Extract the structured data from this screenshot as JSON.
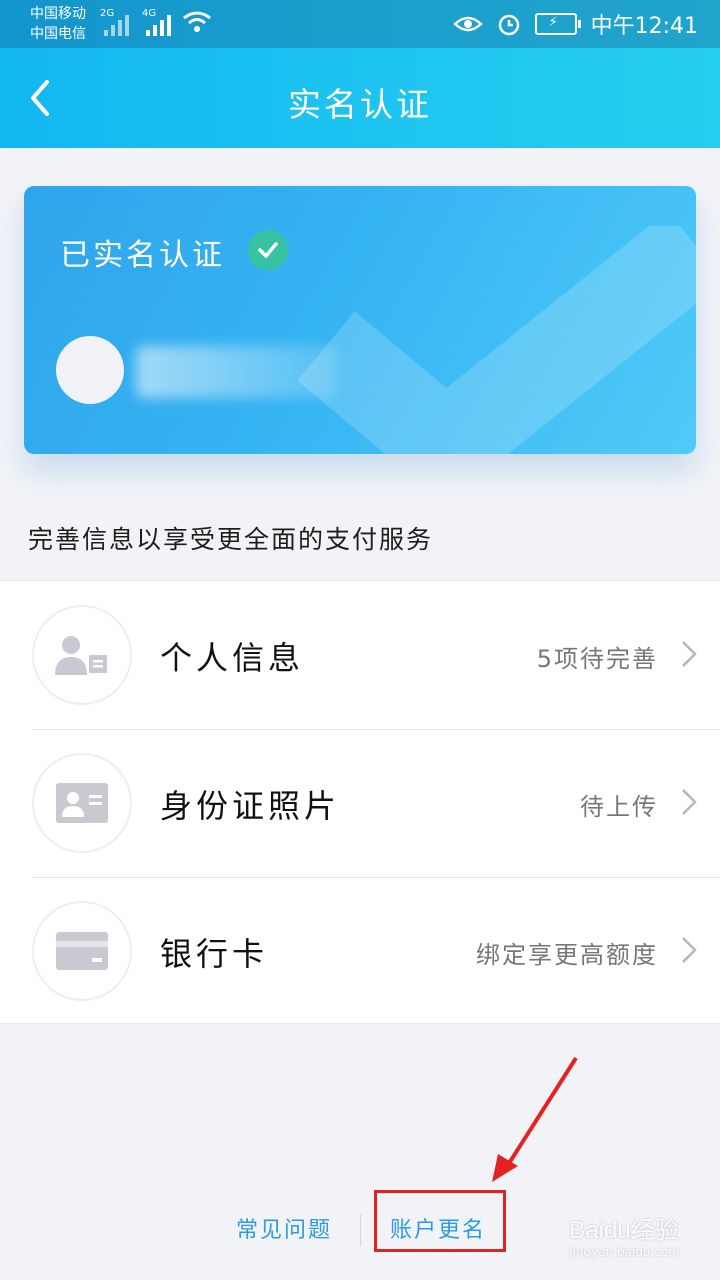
{
  "status_bar": {
    "carrier_1": "中国移动",
    "carrier_2": "中国电信",
    "net_1": "2G",
    "net_2": "4G",
    "time": "中午12:41"
  },
  "header": {
    "title": "实名认证",
    "back_icon": "chevron-left-icon"
  },
  "card": {
    "title": "已实名认证",
    "verified_icon": "check-circle-icon"
  },
  "info_hint": "完善信息以享受更全面的支付服务",
  "list": {
    "items": [
      {
        "label": "个人信息",
        "value": "5项待完善",
        "icon": "person-card-icon"
      },
      {
        "label": "身份证照片",
        "value": "待上传",
        "icon": "id-card-icon"
      },
      {
        "label": "银行卡",
        "value": "绑定享更高额度",
        "icon": "bank-card-icon"
      }
    ]
  },
  "footer": {
    "faq": "常见问题",
    "rename": "账户更名"
  },
  "watermark": {
    "main": "Baidu经验",
    "sub": "jingyan.baidu.com"
  },
  "colors": {
    "header": "#1fc6f0",
    "card": "#35b4f2",
    "verified": "#37c3a2",
    "link": "#2a9be4",
    "annotation": "#e52222"
  }
}
